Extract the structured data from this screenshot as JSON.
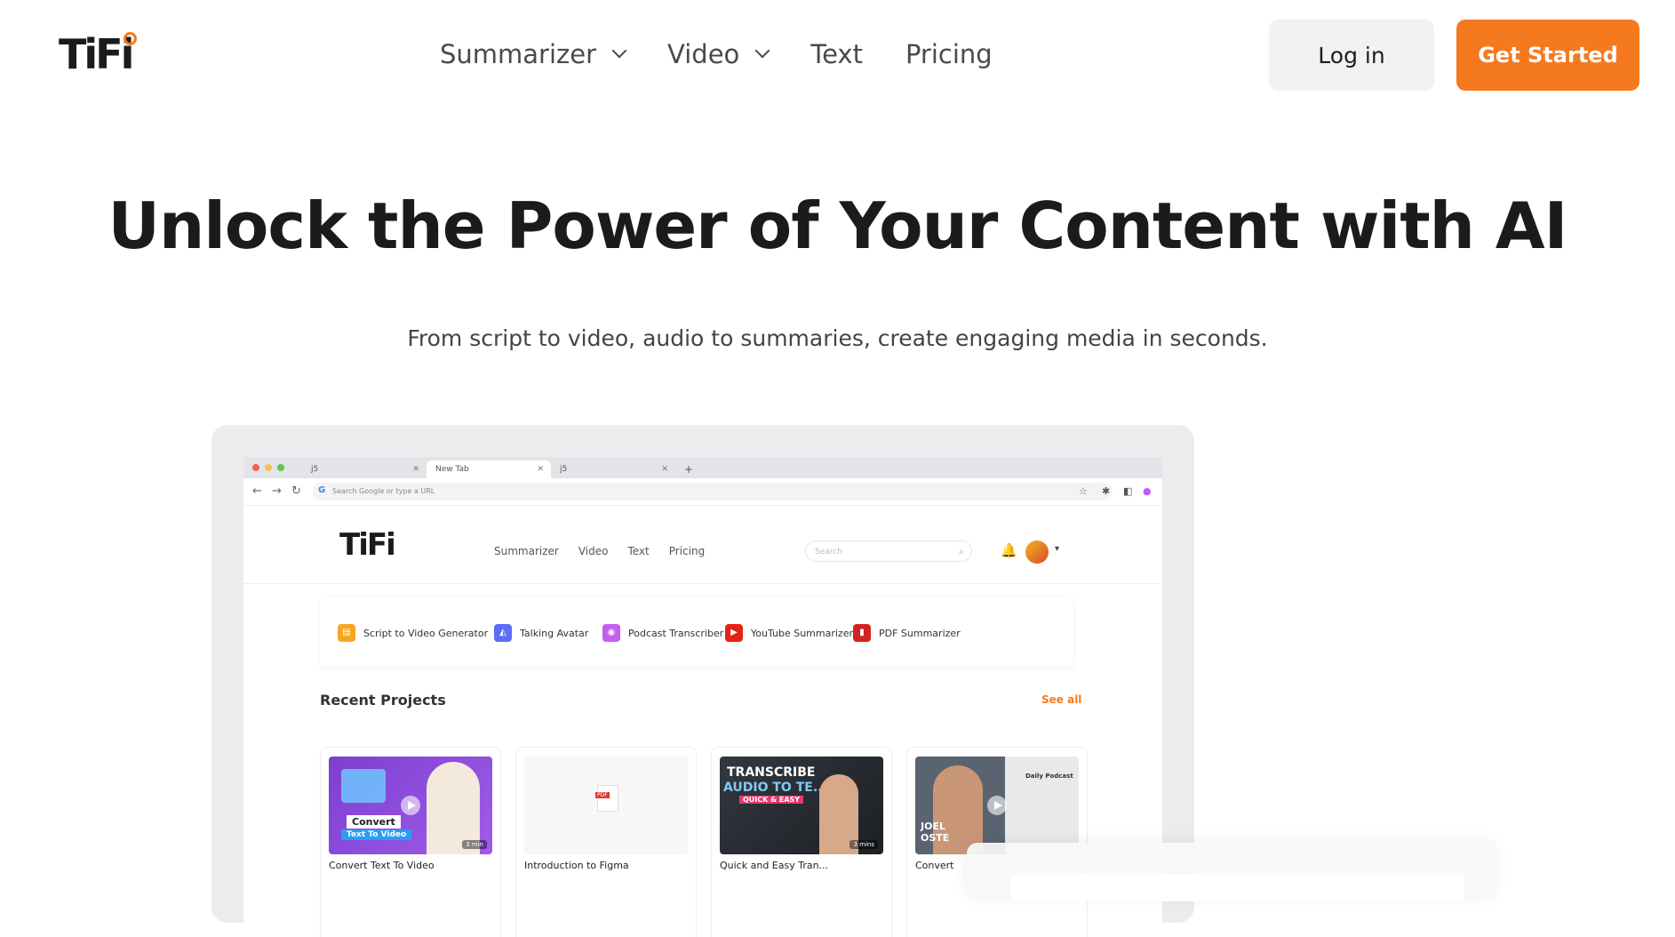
{
  "brand": {
    "name": "TiFi",
    "accent": "#f57a1f"
  },
  "nav": {
    "items": [
      {
        "label": "Summarizer",
        "has_dropdown": true
      },
      {
        "label": "Video",
        "has_dropdown": true
      },
      {
        "label": "Text",
        "has_dropdown": false
      },
      {
        "label": "Pricing",
        "has_dropdown": false
      }
    ],
    "login_label": "Log in",
    "cta_label": "Get Started"
  },
  "hero": {
    "title": "Unlock the Power of Your Content with AI",
    "subtitle": "From script to video, audio to summaries, create engaging media in seconds."
  },
  "mockup": {
    "browser": {
      "tabs": [
        "j5",
        "New Tab",
        "j5"
      ],
      "url_placeholder": "Search Google or type a URL"
    },
    "app": {
      "logo": "TiFi",
      "menu": [
        "Summarizer",
        "Video",
        "Text",
        "Pricing"
      ],
      "search_placeholder": "Search",
      "tools": [
        {
          "label": "Script to Video Generator",
          "icon": "chat-icon",
          "color": "#f5a623"
        },
        {
          "label": "Talking Avatar",
          "icon": "avatar-icon",
          "color": "#5b6ef5"
        },
        {
          "label": "Podcast Transcriber",
          "icon": "podcast-icon",
          "color": "#c45ef0"
        },
        {
          "label": "YouTube Summarizer",
          "icon": "youtube-icon",
          "color": "#e62117"
        },
        {
          "label": "PDF Summarizer",
          "icon": "pdf-icon",
          "color": "#d32222"
        }
      ],
      "recent_title": "Recent Projects",
      "see_all": "See all",
      "projects": [
        {
          "title": "Convert Text To Video",
          "thumb_line1": "Convert",
          "thumb_line2": "Text To Video",
          "duration": "3 min"
        },
        {
          "title": "Introduction to Figma",
          "thumb_line1": "PDF",
          "duration": ""
        },
        {
          "title": "Quick and Easy Tran...",
          "thumb_line1": "TRANSCRIBE",
          "thumb_line2": "AUDIO TO TE...",
          "thumb_line3": "QUICK & EASY",
          "duration": "3 mins"
        },
        {
          "title": "Convert",
          "thumb_line1": "JOEL",
          "thumb_line2": "OSTE",
          "thumb_side": "Daily Podcast",
          "duration": ""
        }
      ]
    }
  }
}
